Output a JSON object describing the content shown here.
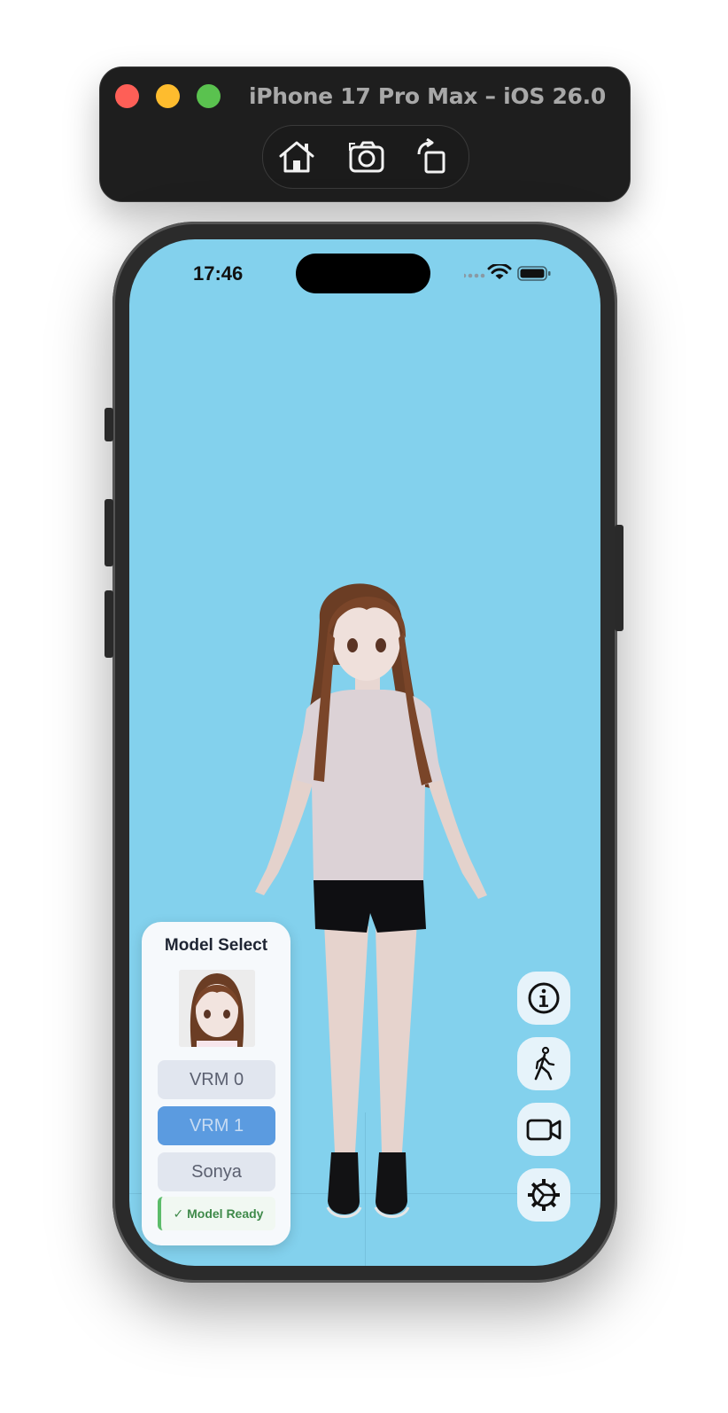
{
  "simulator": {
    "title": "iPhone 17 Pro Max – iOS 26.0",
    "tools": [
      {
        "icon": "home-icon"
      },
      {
        "icon": "screenshot-icon"
      },
      {
        "icon": "rotate-icon"
      }
    ]
  },
  "status_bar": {
    "time": "17:46",
    "icons": [
      "signal-icon",
      "wifi-icon",
      "battery-icon"
    ]
  },
  "model_select": {
    "title": "Model Select",
    "options": [
      {
        "label": "VRM 0",
        "selected": false
      },
      {
        "label": "VRM 1",
        "selected": true
      },
      {
        "label": "Sonya",
        "selected": false
      }
    ],
    "status": "✓ Model Ready"
  },
  "side_controls": [
    {
      "icon": "info-icon"
    },
    {
      "icon": "walk-icon"
    },
    {
      "icon": "video-camera-icon"
    },
    {
      "icon": "settings-gear-icon"
    }
  ],
  "colors": {
    "scene_background": "#83d1ed",
    "selected_button": "#5b9be0",
    "ready_accent": "#5cbc6a"
  }
}
